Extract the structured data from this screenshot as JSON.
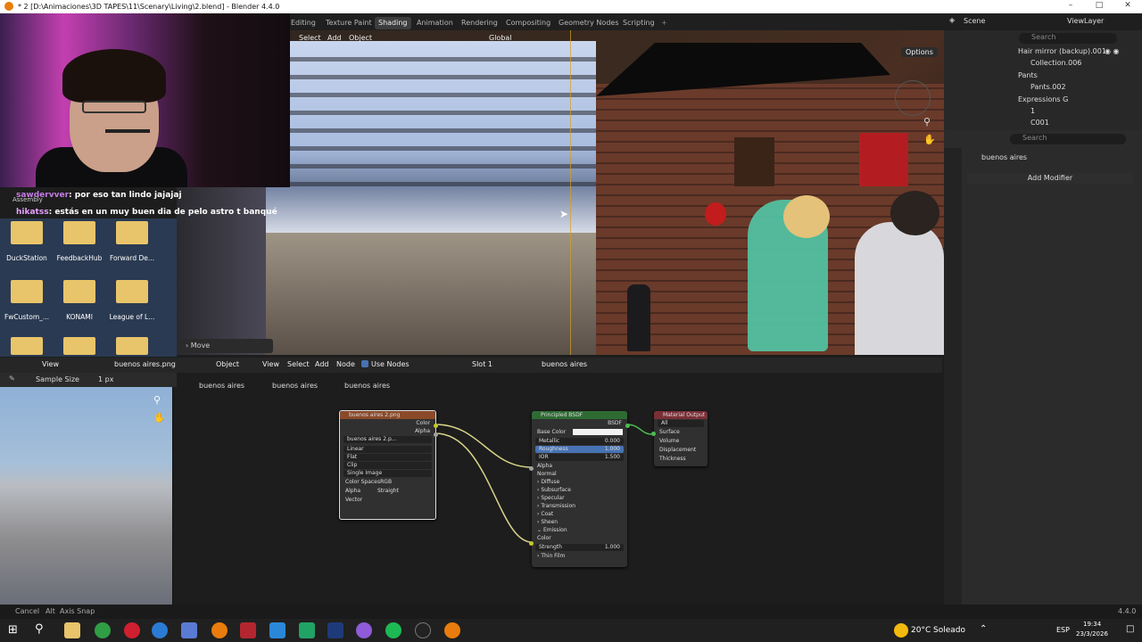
{
  "window": {
    "title": "* 2 [D:\\Animaciones\\3D TAPES\\11\\Scenary\\Living\\2.blend] - Blender 4.4.0"
  },
  "workspaces": [
    "Editing",
    "Texture Paint",
    "Shading",
    "Animation",
    "Rendering",
    "Compositing",
    "Geometry Nodes",
    "Scripting"
  ],
  "active_workspace": "Shading",
  "scene": "Scene",
  "view_layer": "ViewLayer",
  "viewport": {
    "menus": [
      "Select",
      "Add",
      "Object"
    ],
    "orientation": "Global",
    "options": "Options",
    "last_op": "Move"
  },
  "chat": [
    {
      "user": "sawdervver",
      "message": "por eso tan lindo jajajaj"
    },
    {
      "user": "hikatss",
      "message": "estás en un muy buen dia de pelo astro t banqué"
    }
  ],
  "desktop": {
    "partial": "Assembly",
    "rows": [
      [
        "DuckStation",
        "FeedbackHub",
        "Forward De..."
      ],
      [
        "FwCustom_...",
        "KONAMI",
        "League of L..."
      ]
    ]
  },
  "image_editor": {
    "menu": "View",
    "image": "buenos aires.png",
    "tool": "Sample Size",
    "tool_value": "1 px"
  },
  "node_editor": {
    "mode": "Object",
    "menus": [
      "View",
      "Select",
      "Add",
      "Node"
    ],
    "use_nodes": "Use Nodes",
    "slot": "Slot 1",
    "material": "buenos aires",
    "breadcrumb": [
      "buenos aires",
      "buenos aires",
      "buenos aires"
    ]
  },
  "nodes": {
    "image": {
      "title": "buenos aires 2.png",
      "outputs": [
        "Color",
        "Alpha"
      ],
      "file": "buenos aires 2.p...",
      "interp": "Linear",
      "proj": "Flat",
      "ext": "Clip",
      "src": "Single Image",
      "cs_label": "Color Space",
      "cs": "sRGB",
      "alpha_label": "Alpha",
      "alpha": "Straight",
      "vector": "Vector"
    },
    "bsdf": {
      "title": "Principled BSDF",
      "out": "BSDF",
      "base": "Base Color",
      "rows": [
        {
          "label": "Metallic",
          "value": "0.000"
        },
        {
          "label": "Roughness",
          "value": "1.000"
        },
        {
          "label": "IOR",
          "value": "1.500"
        }
      ],
      "alpha": "Alpha",
      "normal": "Normal",
      "panels": [
        "Diffuse",
        "Subsurface",
        "Specular",
        "Transmission",
        "Coat",
        "Sheen",
        "Emission"
      ],
      "color": "Color",
      "strength_label": "Strength",
      "strength": "1.000",
      "thin": "Thin Film"
    },
    "output": {
      "title": "Material Output",
      "target": "All",
      "inputs": [
        "Surface",
        "Volume",
        "Displacement",
        "Thickness"
      ]
    }
  },
  "outliner": {
    "search": "Search",
    "rows": [
      "Hair mirror (backup).001",
      "Collection.006",
      "Pants",
      "Pants.002",
      "Expressions G",
      "1",
      "C001"
    ]
  },
  "properties": {
    "search": "Search",
    "object": "buenos aires",
    "add_modifier": "Add Modifier"
  },
  "status": {
    "cancel": "Cancel",
    "axis_label": "Alt",
    "axis": "Axis Snap",
    "version": "4.4.0"
  },
  "taskbar": {
    "temp": "20°C",
    "weather": "Soleado",
    "lang": "ESP",
    "time": "19:34",
    "date": "23/3/2026"
  },
  "colors": {
    "accent": "#4772b3",
    "image_node": "#8a4a2a",
    "bsdf_node": "#2e6b33",
    "output_node": "#7a2f37",
    "link": "#d9d58a",
    "socket_yellow": "#c7c729",
    "socket_gray": "#a1a1a1",
    "socket_green": "#4bbd4f"
  }
}
